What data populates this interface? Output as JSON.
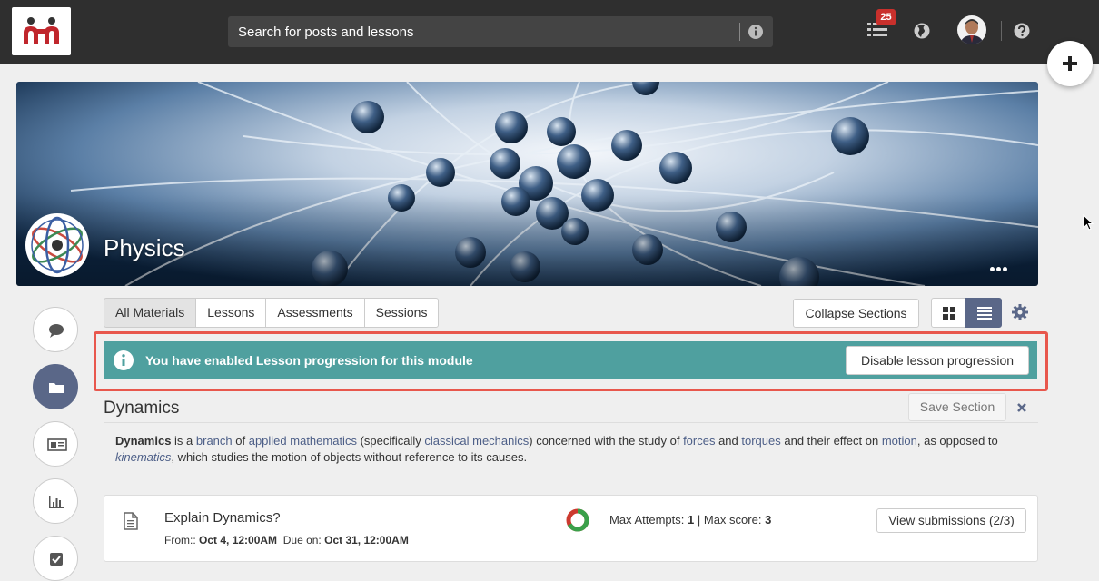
{
  "header": {
    "search_placeholder": "Search for posts and lessons",
    "notifications_count": "25"
  },
  "module": {
    "title": "Physics"
  },
  "filters": {
    "tabs": [
      "All Materials",
      "Lessons",
      "Assessments",
      "Sessions"
    ],
    "active_tab": "All Materials",
    "collapse_label": "Collapse Sections",
    "active_view": "list"
  },
  "alert": {
    "message": "You have enabled Lesson progression for this module",
    "button_label": "Disable lesson progression"
  },
  "section": {
    "title": "Dynamics",
    "save_label": "Save Section",
    "description": {
      "t1": "Dynamics",
      "t2": " is a ",
      "l1": "branch",
      "t3": " of ",
      "l2": "applied mathematics",
      "t4": " (specifically ",
      "l3": "classical mechanics",
      "t5": ") concerned with the study of ",
      "l4": "forces",
      "t6": " and ",
      "l5": "torques",
      "t7": " and their effect on ",
      "l6": "motion",
      "t8": ", as opposed to ",
      "l7": "kinematics",
      "t9": ", which studies the motion of objects without reference to its causes."
    }
  },
  "assessment": {
    "title": "Explain Dynamics?",
    "from_label": "From::",
    "from_value": "Oct 4, 12:00AM",
    "due_label": "Due on:",
    "due_value": "Oct 31, 12:00AM",
    "max_attempts_label": "Max Attempts:",
    "max_attempts": "1",
    "separator": "|",
    "max_score_label": "Max score:",
    "max_score": "3",
    "submissions_label": "View submissions (2/3)",
    "submissions_done": 2,
    "submissions_total": 3
  },
  "colors": {
    "topbar": "#2f2f2f",
    "accent": "#5a6788",
    "alert": "#4fa09f",
    "highlight": "#e8574d",
    "badge": "#c9302c"
  }
}
